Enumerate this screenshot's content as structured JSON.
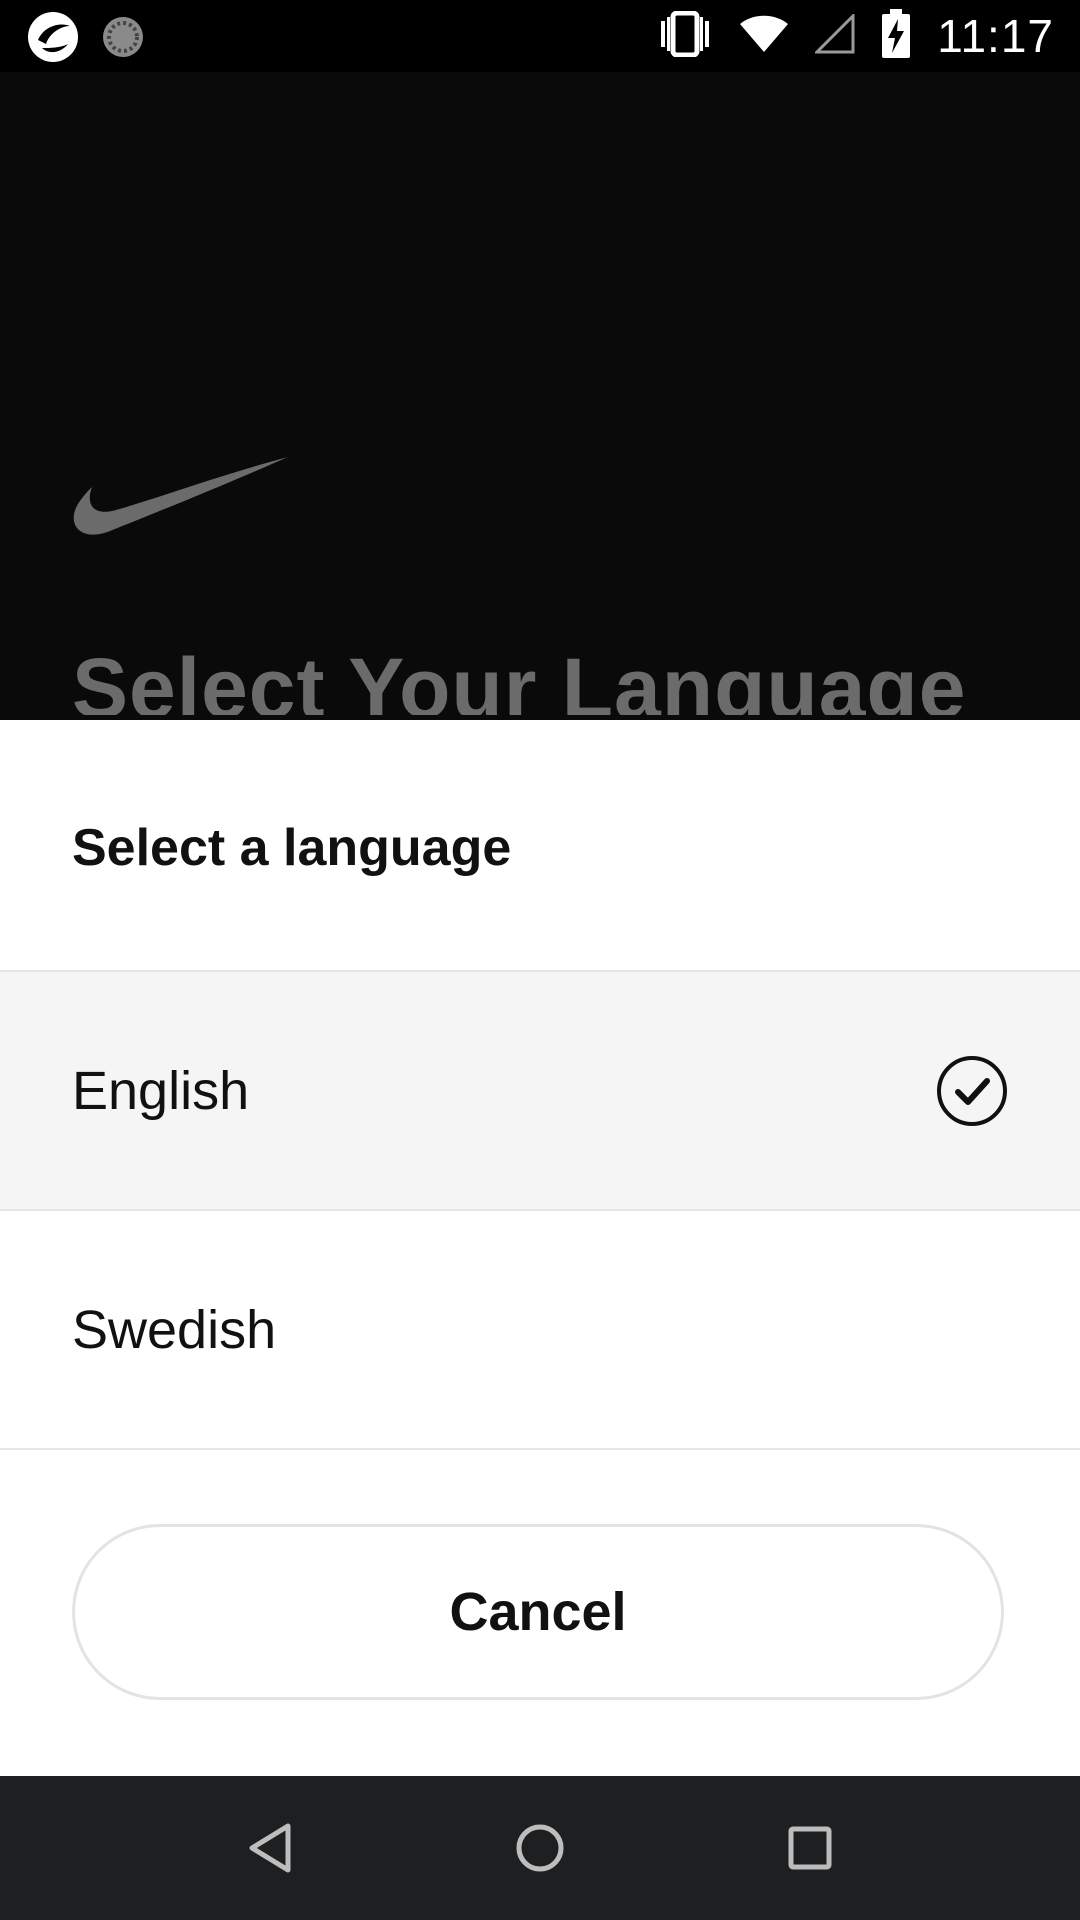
{
  "status_bar": {
    "time": "11:17",
    "left_icons": [
      "nike-app-icon",
      "loading-spinner-icon"
    ],
    "right_icons": [
      "vibrate-icon",
      "wifi-icon",
      "cell-signal-icon",
      "battery-charging-icon"
    ]
  },
  "background": {
    "logo": "nike-swoosh-logo",
    "title": "Select Your Language"
  },
  "sheet": {
    "title": "Select a language",
    "options": [
      {
        "label": "English",
        "selected": true
      },
      {
        "label": "Swedish",
        "selected": false
      }
    ],
    "cancel_label": "Cancel"
  },
  "nav_bar": {
    "icons": [
      "back-icon",
      "home-icon",
      "recents-icon"
    ]
  },
  "colors": {
    "sheet_bg": "#ffffff",
    "selected_bg": "#f5f5f5",
    "text": "#111111",
    "dim_title": "#6b6b6b",
    "nav_bg": "#1d1f21"
  }
}
